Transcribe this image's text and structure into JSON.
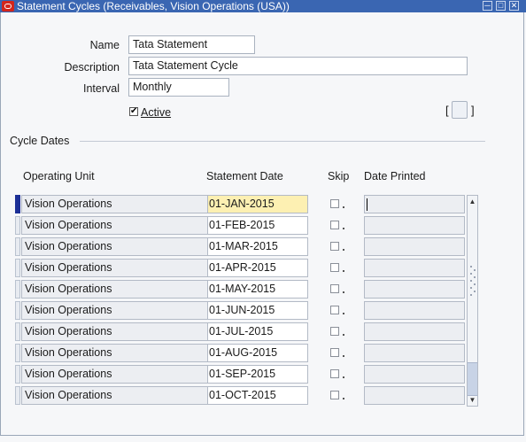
{
  "window": {
    "title": "Statement Cycles (Receivables, Vision Operations (USA))",
    "controls": [
      "minimize-icon",
      "maximize-icon",
      "close-icon"
    ]
  },
  "header": {
    "name_label": "Name",
    "name_value": "Tata Statement",
    "description_label": "Description",
    "description_value": "Tata Statement Cycle",
    "interval_label": "Interval",
    "interval_value": "Monthly",
    "active_label": "Active",
    "active_checked": true,
    "bracket_open": "[",
    "bracket_close": "]"
  },
  "cycle_dates": {
    "section_title": "Cycle Dates",
    "columns": {
      "operating_unit": "Operating Unit",
      "statement_date": "Statement Date",
      "skip": "Skip",
      "date_printed": "Date Printed"
    },
    "rows": [
      {
        "operating_unit": "Vision Operations",
        "statement_date": "01-JAN-2015",
        "skip": false,
        "date_printed": ""
      },
      {
        "operating_unit": "Vision Operations",
        "statement_date": "01-FEB-2015",
        "skip": false,
        "date_printed": ""
      },
      {
        "operating_unit": "Vision Operations",
        "statement_date": "01-MAR-2015",
        "skip": false,
        "date_printed": ""
      },
      {
        "operating_unit": "Vision Operations",
        "statement_date": "01-APR-2015",
        "skip": false,
        "date_printed": ""
      },
      {
        "operating_unit": "Vision Operations",
        "statement_date": "01-MAY-2015",
        "skip": false,
        "date_printed": ""
      },
      {
        "operating_unit": "Vision Operations",
        "statement_date": "01-JUN-2015",
        "skip": false,
        "date_printed": ""
      },
      {
        "operating_unit": "Vision Operations",
        "statement_date": "01-JUL-2015",
        "skip": false,
        "date_printed": ""
      },
      {
        "operating_unit": "Vision Operations",
        "statement_date": "01-AUG-2015",
        "skip": false,
        "date_printed": ""
      },
      {
        "operating_unit": "Vision Operations",
        "statement_date": "01-SEP-2015",
        "skip": false,
        "date_printed": ""
      },
      {
        "operating_unit": "Vision Operations",
        "statement_date": "01-OCT-2015",
        "skip": false,
        "date_printed": ""
      }
    ],
    "current_row": 0
  },
  "colors": {
    "titlebar": "#3a66b2",
    "current_field": "#fdf0b2",
    "row_indicator_active": "#1c2f96"
  }
}
